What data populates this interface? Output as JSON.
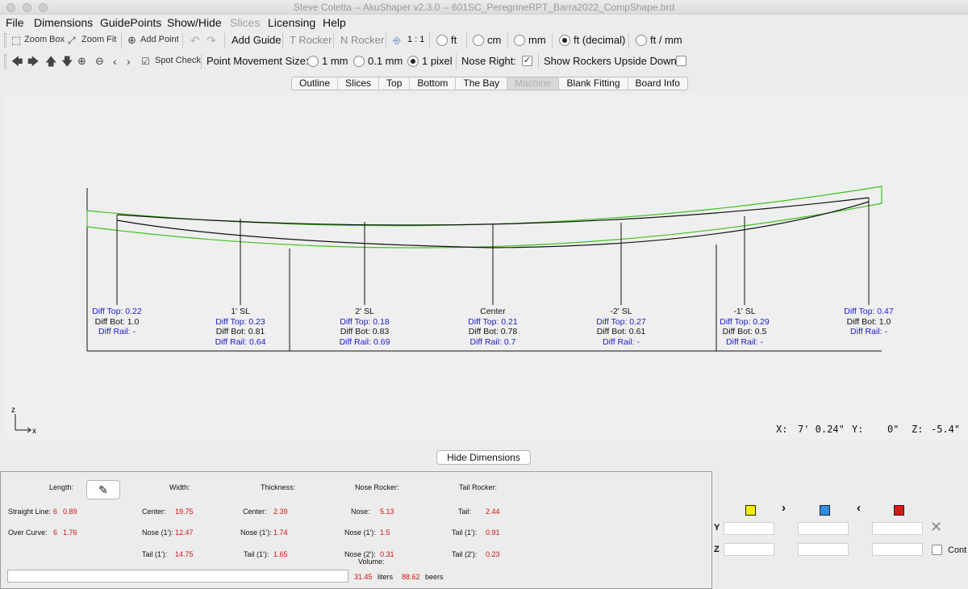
{
  "window": {
    "title": "Steve Coletta -- AkuShaper v2.3.0  --  601SC_PeregrineRPT_Barra2022_CompShape.brd"
  },
  "menu": [
    "File",
    "Dimensions",
    "GuidePoints",
    "Show/Hide",
    "Slices",
    "Licensing",
    "Help"
  ],
  "toolbar1": {
    "zoom_box": "Zoom Box",
    "zoom_fit": "Zoom Fit",
    "add_point": "Add Point",
    "add_guide": "Add Guide",
    "t_rocker": "T Rocker",
    "n_rocker": "N Rocker",
    "scale": "1 : 1",
    "units": [
      "ft",
      "cm",
      "mm",
      "ft (decimal)",
      "ft / mm"
    ],
    "selected_unit": "ft (decimal)"
  },
  "toolbar2": {
    "spot_check": "Spot Check",
    "point_movement_label": "Point Movement Size:",
    "movement_options": [
      "1 mm",
      "0.1 mm",
      "1 pixel"
    ],
    "selected_movement": "1 pixel",
    "nose_right_label": "Nose Right:",
    "nose_right_checked": true,
    "rockers_upside_label": "Show Rockers Upside Down:",
    "rockers_upside_checked": false
  },
  "tabs": [
    "Outline",
    "Slices",
    "Top",
    "Bottom",
    "The Bay",
    "Machine",
    "Blank Fitting",
    "Board Info"
  ],
  "active_tab": "Machine",
  "stations": [
    {
      "title": "",
      "top": "Diff Top: 0.22",
      "bot": "Diff Bot: 1.0",
      "rail": "Diff Rail: -"
    },
    {
      "title": "1' SL",
      "top": "Diff Top: 0.23",
      "bot": "Diff Bot: 0.81",
      "rail": "Diff Rail: 0.64"
    },
    {
      "title": "2' SL",
      "top": "Diff Top: 0.18",
      "bot": "Diff Bot: 0.83",
      "rail": "Diff Rail: 0.69"
    },
    {
      "title": "Center",
      "top": "Diff Top: 0.21",
      "bot": "Diff Bot: 0.78",
      "rail": "Diff Rail: 0.7"
    },
    {
      "title": "-2' SL",
      "top": "Diff Top: 0.27",
      "bot": "Diff Bot: 0.61",
      "rail": "Diff Rail: -"
    },
    {
      "title": "-1' SL",
      "top": "Diff Top: 0.29",
      "bot": "Diff Bot: 0.5",
      "rail": "Diff Rail: -"
    },
    {
      "title": "",
      "top": "Diff Top: 0.47",
      "bot": "Diff Bot: 1.0",
      "rail": "Diff Rail: -"
    }
  ],
  "axis": {
    "z": "z",
    "x": "x"
  },
  "coords": {
    "x_label": "X:",
    "x": "7' 0.24\"",
    "y_label": "Y:",
    "y": "0\"",
    "z_label": "Z:",
    "z": "-5.4\""
  },
  "hide_dimensions": "Hide Dimensions",
  "dimensions": {
    "length_label": "Length:",
    "straight_line_label": "Straight Line:",
    "straight_line_ft": "6",
    "straight_line_in": "0.89",
    "over_curve_label": "Over Curve:",
    "over_curve_ft": "6",
    "over_curve_in": "1.76",
    "width_label": "Width:",
    "width_center_label": "Center:",
    "width_center": "19.75",
    "width_nose_label": "Nose (1'):",
    "width_nose": "12.47",
    "width_tail_label": "Tail (1'):",
    "width_tail": "14.75",
    "thickness_label": "Thickness:",
    "thick_center_label": "Center:",
    "thick_center": "2.39",
    "thick_nose_label": "Nose (1'):",
    "thick_nose": "1.74",
    "thick_tail_label": "Tail (1'):",
    "thick_tail": "1.65",
    "nose_rocker_label": "Nose Rocker:",
    "nr_nose_label": "Nose:",
    "nr_nose": "5.13",
    "nr_nose1_label": "Nose (1'):",
    "nr_nose1": "1.5",
    "nr_nose2_label": "Nose (2'):",
    "nr_nose2": "0.31",
    "tail_rocker_label": "Tail Rocker:",
    "tr_tail_label": "Tail:",
    "tr_tail": "2.44",
    "tr_tail1_label": "Tail (1'):",
    "tr_tail1": "0.91",
    "tr_tail2_label": "Tail (2'):",
    "tr_tail2": "0.23",
    "volume_label": "Volume:",
    "volume_liters": "31.45",
    "liters_label": "liters",
    "volume_beers": "88.62",
    "beers_label": "beers"
  },
  "guide_editor": {
    "y_label": "Y",
    "z_label": "Z",
    "cont_label": "Cont",
    "swatch_colors": [
      "#f5f000",
      "#2f8ee0",
      "#e01515"
    ]
  }
}
